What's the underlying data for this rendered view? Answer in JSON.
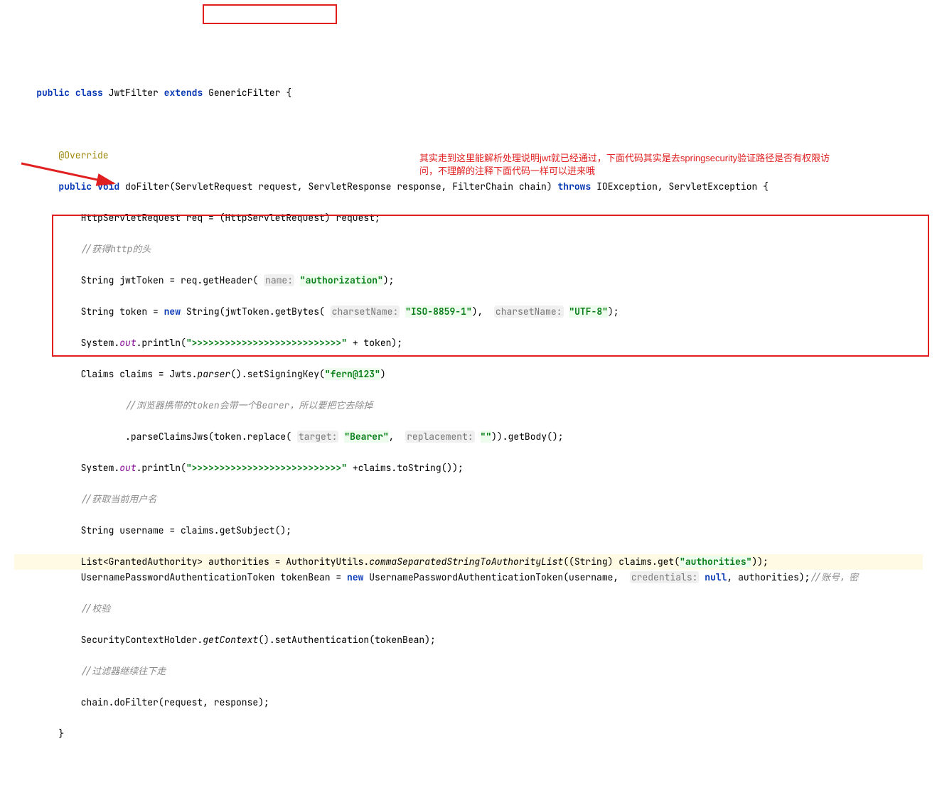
{
  "code": {
    "l1": {
      "kw_public": "public",
      "kw_class": "class",
      "classname": "JwtFilter",
      "kw_extends": "extends",
      "superclass": "GenericFilter",
      "brace": "{"
    },
    "l3": {
      "ann": "@Override"
    },
    "l4": {
      "kw_public": "public",
      "kw_void": "void",
      "method": "doFilter",
      "params": "(ServletRequest request, ServletResponse response, FilterChain chain)",
      "kw_throws": "throws",
      "ex": "IOException, ServletException {"
    },
    "l5": {
      "text": "HttpServletRequest req = (HttpServletRequest) request;"
    },
    "l6": {
      "comment": "//获得http的头"
    },
    "l7": {
      "p1": "String jwtToken = req.getHeader(",
      "hint": "name:",
      "str": "\"authorization\"",
      "p2": ");"
    },
    "l8": {
      "p1": "String token = ",
      "kw_new": "new",
      "p2": " String(jwtToken.getBytes(",
      "hint1": "charsetName:",
      "str1": "\"ISO-8859-1\"",
      "p3": "), ",
      "hint2": "charsetName:",
      "str2": "\"UTF-8\"",
      "p4": ");"
    },
    "l9": {
      "p1": "System.",
      "out": "out",
      "p2": ".println(",
      "str": "\">>>>>>>>>>>>>>>>>>>>>>>>>>>\"",
      "p3": " + token);"
    },
    "l10": {
      "p1": "Claims claims = Jwts.",
      "parser": "parser",
      "p2": "().setSigningKey(",
      "str": "\"fern@123\"",
      "p3": ")"
    },
    "l11": {
      "comment": "//浏览器携带的token会带一个Bearer，所以要把它去除掉"
    },
    "l12": {
      "p1": ".parseClaimsJws(token.replace(",
      "hint1": "target:",
      "str1": "\"Bearer\"",
      "p2": ", ",
      "hint2": "replacement:",
      "str2": "\"\"",
      "p3": ")).getBody();"
    },
    "l13": {
      "p1": "System.",
      "out": "out",
      "p2": ".println(",
      "str": "\">>>>>>>>>>>>>>>>>>>>>>>>>>>\"",
      "p3": " +claims.toString());"
    },
    "l14": {
      "comment": "//获取当前用户名"
    },
    "l15": {
      "text": "String username = claims.getSubject();"
    },
    "l16": {
      "p1": "List",
      "p2": "<GrantedAuthority> authorities = AuthorityUtils.",
      "m": "commaSeparatedStringToAuthorityList",
      "p3": "((String) claims.get(",
      "str": "\"authorities\"",
      "p4": "));"
    },
    "l17": {
      "p1": "UsernamePasswordAuthenticationToken tokenBean = ",
      "kw_new": "new",
      "p2": " UsernamePasswordAuthenticationToken(username, ",
      "hint": "credentials:",
      "kw_null": "null",
      "p3": ", authorities);",
      "comment": "//账号，密"
    },
    "l18": {
      "comment": "//校验"
    },
    "l19": {
      "p1": "SecurityContextHolder.",
      "m": "getContext",
      "p2": "().setAuthentication(tokenBean);"
    },
    "l20": {
      "comment": "//过滤器继续往下走"
    },
    "l21": {
      "text": "chain.doFilter(request, response);"
    },
    "l22": {
      "brace": "}"
    }
  },
  "annotation": {
    "red_text": "其实走到这里能解析处理说明jwt就已经通过，下面代码其实是去springsecurity验证路径是否有权限访问，不理解的注释下面代码一样可以进来哦"
  }
}
